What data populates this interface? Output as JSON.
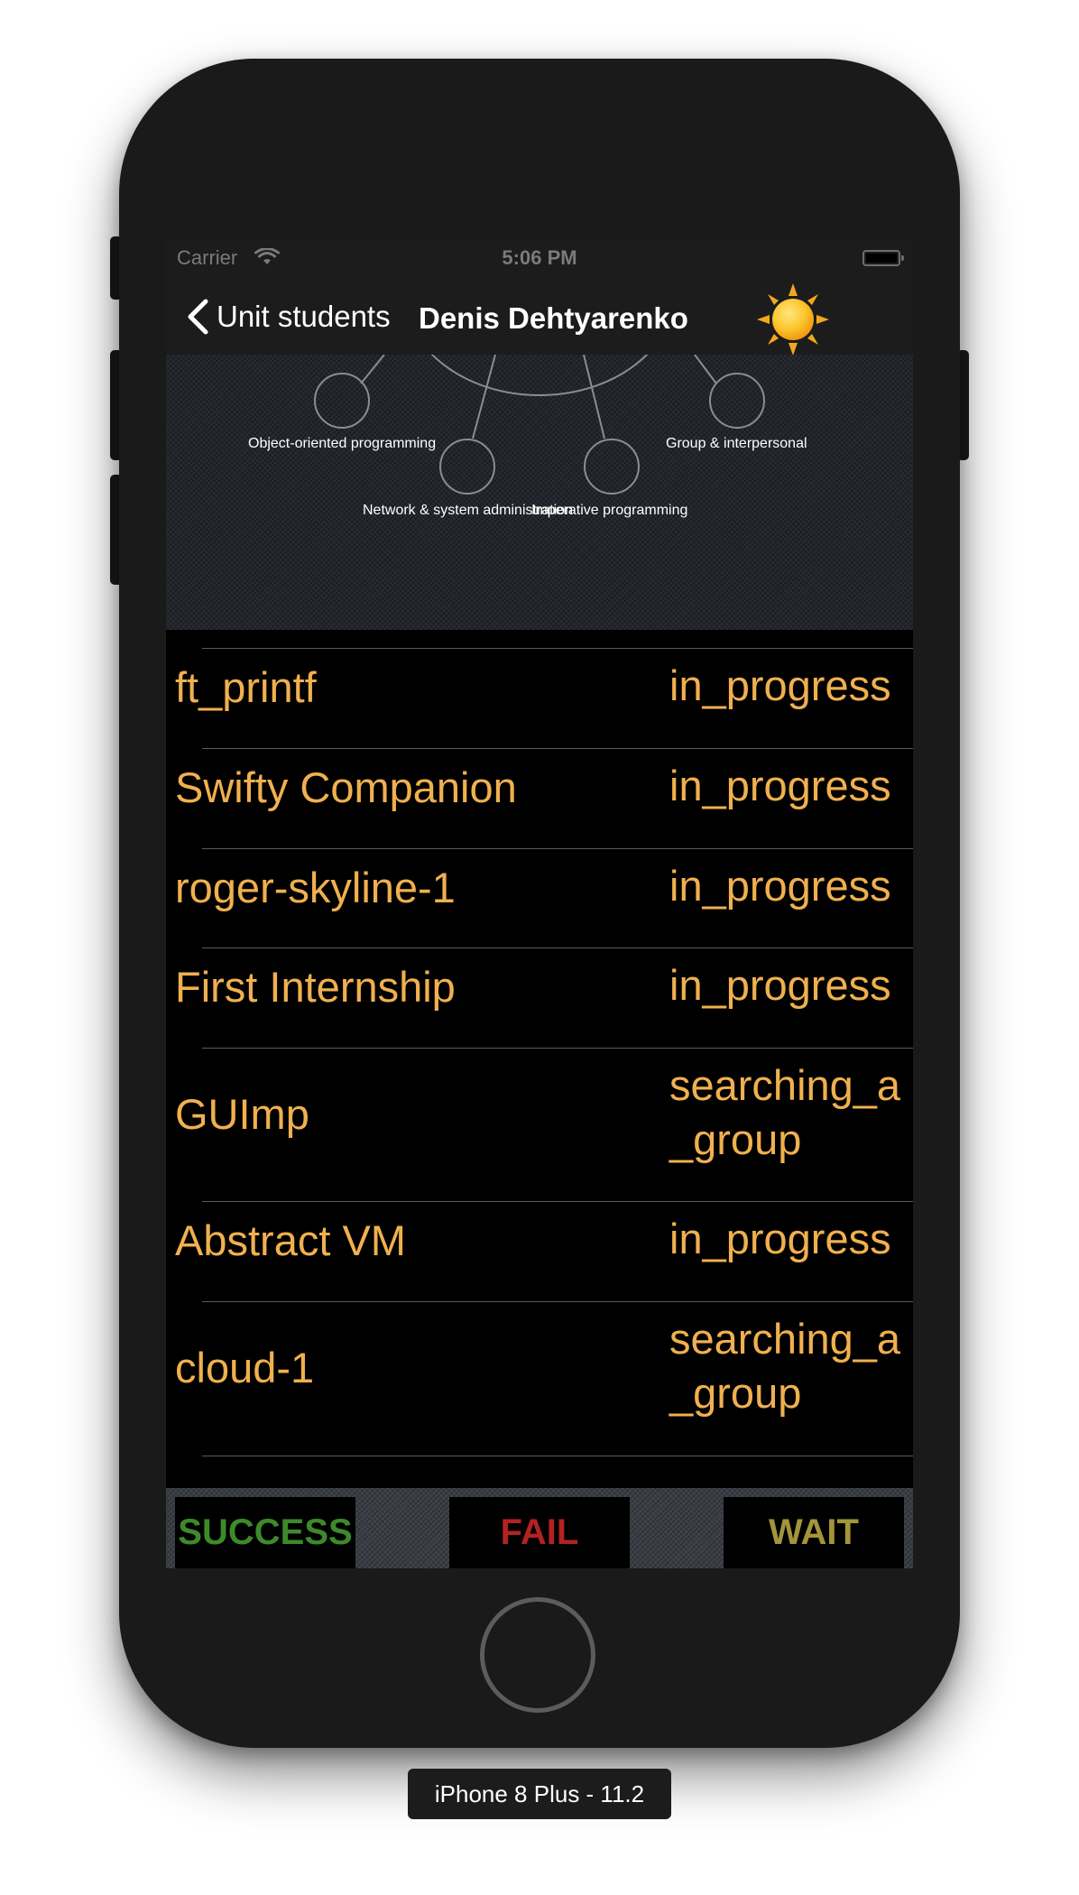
{
  "status_bar": {
    "carrier": "Carrier",
    "time": "5:06 PM"
  },
  "nav": {
    "back_label": "Unit students",
    "title": "Denis Dehtyarenko",
    "right_icon": "sun-icon"
  },
  "skills": [
    "Object-oriented programming",
    "Group & interpersonal",
    "Network & system administration",
    "Imperative programming"
  ],
  "projects": [
    {
      "name": "ft_printf",
      "status": "in_progress"
    },
    {
      "name": "Swifty Companion",
      "status": "in_progress"
    },
    {
      "name": "roger-skyline-1",
      "status": "in_progress"
    },
    {
      "name": "First Internship",
      "status": "in_progress"
    },
    {
      "name": "GUImp",
      "status": "searching_a_group"
    },
    {
      "name": "Abstract VM",
      "status": "in_progress"
    },
    {
      "name": "cloud-1",
      "status": "searching_a_group"
    }
  ],
  "buttons": {
    "success": "SUCCESS",
    "fail": "FAIL",
    "wait": "WAIT"
  },
  "colors": {
    "accent_orange": "#f0b04f",
    "success_green": "#3d8a2a",
    "fail_red": "#b22222",
    "wait_olive": "#a2953a"
  },
  "device_label": "iPhone 8 Plus - 11.2"
}
